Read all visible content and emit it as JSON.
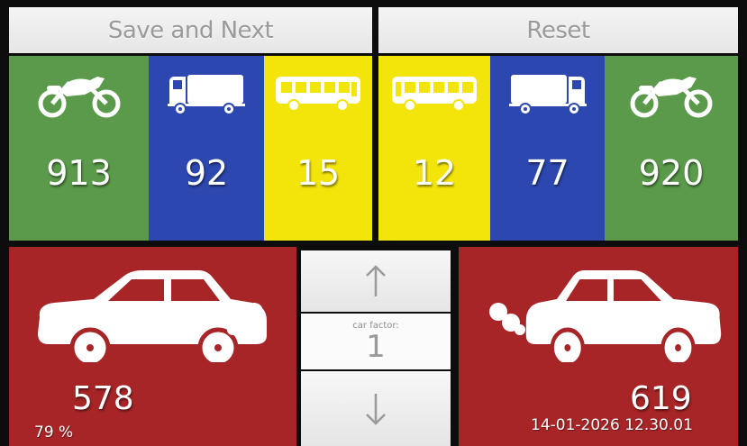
{
  "toolbar": {
    "save_next_label": "Save and Next",
    "reset_label": "Reset"
  },
  "left_tiles": [
    {
      "vehicle": "motorcycle-icon",
      "count": "913",
      "color": "#5a9a4a"
    },
    {
      "vehicle": "truck-icon",
      "count": "92",
      "color": "#2c48b0"
    },
    {
      "vehicle": "bus-icon",
      "count": "15",
      "color": "#f3e40a"
    }
  ],
  "right_tiles": [
    {
      "vehicle": "bus-icon",
      "count": "12",
      "color": "#f3e40a"
    },
    {
      "vehicle": "truck-icon",
      "count": "77",
      "color": "#2c48b0"
    },
    {
      "vehicle": "motorcycle-icon",
      "count": "920",
      "color": "#5a9a4a"
    }
  ],
  "left_car": {
    "icon": "car-icon",
    "count": "578",
    "percent": "79 %",
    "color": "#a72527"
  },
  "right_car": {
    "icon": "car-icon",
    "count": "619",
    "timestamp": "14-01-2026 12.30.01",
    "color": "#a72527"
  },
  "car_factor": {
    "label": "car factor:",
    "value": "1",
    "up_arrow": "↑",
    "down_arrow": "↓"
  }
}
